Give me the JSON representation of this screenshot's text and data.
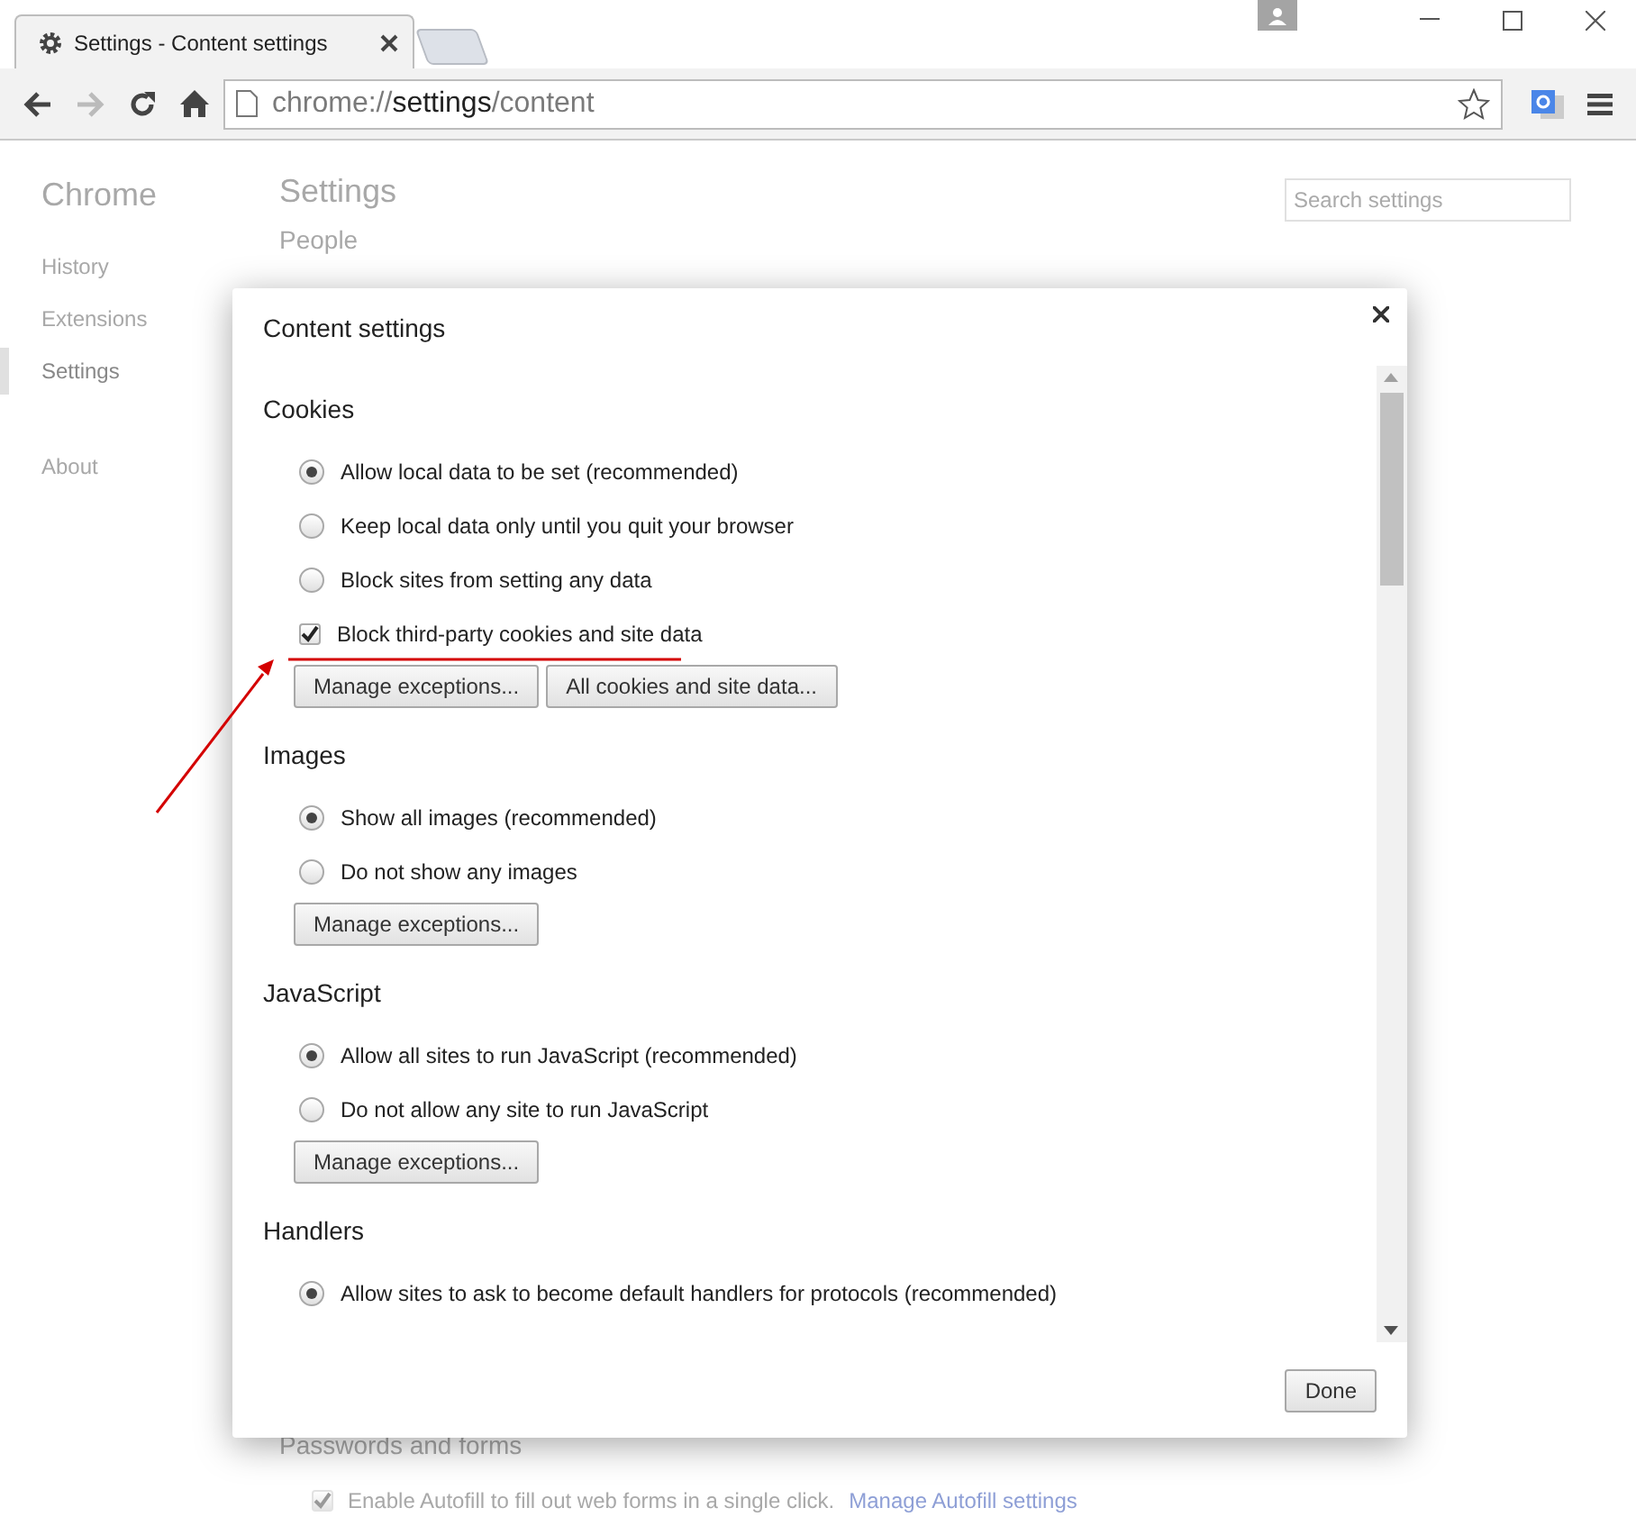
{
  "browser": {
    "tab": {
      "title": "Settings - Content settings"
    },
    "url": {
      "scheme": "chrome://",
      "host": "settings",
      "path": "/content"
    }
  },
  "page": {
    "sidebar": {
      "title": "Chrome",
      "items": [
        {
          "label": "History",
          "selected": false
        },
        {
          "label": "Extensions",
          "selected": false
        },
        {
          "label": "Settings",
          "selected": true
        },
        {
          "label": "About",
          "selected": false
        }
      ]
    },
    "heading": "Settings",
    "section": "People",
    "search": {
      "placeholder": "Search settings"
    },
    "lower_section": "Passwords and forms",
    "autofill": {
      "label": "Enable Autofill to fill out web forms in a single click.",
      "checked": true,
      "link": "Manage Autofill settings"
    }
  },
  "dialog": {
    "title": "Content settings",
    "sections": [
      {
        "heading": "Cookies",
        "options": [
          {
            "kind": "radio",
            "label": "Allow local data to be set (recommended)",
            "selected": true
          },
          {
            "kind": "radio",
            "label": "Keep local data only until you quit your browser",
            "selected": false
          },
          {
            "kind": "radio",
            "label": "Block sites from setting any data",
            "selected": false
          },
          {
            "kind": "checkbox",
            "label": "Block third-party cookies and site data",
            "checked": true
          }
        ],
        "buttons": [
          "Manage exceptions...",
          "All cookies and site data..."
        ]
      },
      {
        "heading": "Images",
        "options": [
          {
            "kind": "radio",
            "label": "Show all images (recommended)",
            "selected": true
          },
          {
            "kind": "radio",
            "label": "Do not show any images",
            "selected": false
          }
        ],
        "buttons": [
          "Manage exceptions..."
        ]
      },
      {
        "heading": "JavaScript",
        "options": [
          {
            "kind": "radio",
            "label": "Allow all sites to run JavaScript (recommended)",
            "selected": true
          },
          {
            "kind": "radio",
            "label": "Do not allow any site to run JavaScript",
            "selected": false
          }
        ],
        "buttons": [
          "Manage exceptions..."
        ]
      },
      {
        "heading": "Handlers",
        "options": [
          {
            "kind": "radio",
            "label": "Allow sites to ask to become default handlers for protocols (recommended)",
            "selected": true
          }
        ]
      }
    ],
    "done": "Done"
  }
}
